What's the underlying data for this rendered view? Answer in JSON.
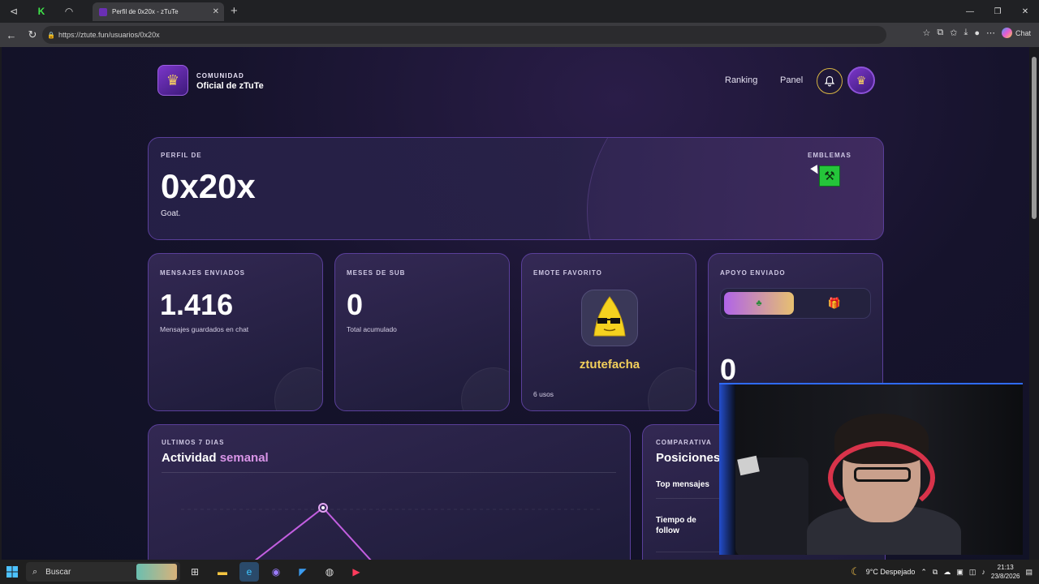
{
  "browser": {
    "tab_title": "Perfil de 0x20x - zTuTe",
    "url": "https://ztute.fun/usuarios/0x20x",
    "chat_label": "Chat"
  },
  "header": {
    "community_label": "COMUNIDAD",
    "community_name": "Oficial de zTuTe",
    "nav": [
      "Ranking",
      "Panel"
    ]
  },
  "profile": {
    "label": "PERFIL DE",
    "username": "0x20x",
    "bio": "Goat.",
    "badges_label": "EMBLEMAS"
  },
  "stats": {
    "messages": {
      "label": "MENSAJES ENVIADOS",
      "value": "1.416",
      "sub": "Mensajes guardados en chat"
    },
    "sub_months": {
      "label": "MESES DE SUB",
      "value": "0",
      "sub": "Total acumulado"
    },
    "emote": {
      "label": "EMOTE FAVORITO",
      "name": "ztutefacha",
      "uses": "6 usos"
    },
    "support": {
      "label": "APOYO ENVIADO",
      "value": "0"
    }
  },
  "activity": {
    "label": "ULTIMOS 7 DIAS",
    "title_a": "Actividad ",
    "title_b": "semanal"
  },
  "positions": {
    "label": "COMPARATIVA",
    "title": "Posiciones",
    "rows": [
      "Top mensajes",
      "Tiempo de\nfollow"
    ]
  },
  "taskbar": {
    "search_placeholder": "Buscar",
    "weather": "9°C  Despejado",
    "time": "21:13",
    "date": "23/8/2026"
  }
}
